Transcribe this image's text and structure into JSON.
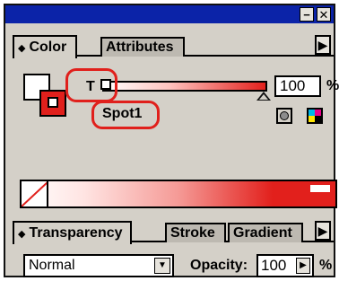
{
  "window": {
    "minimize_label": "−",
    "close_label": "✕"
  },
  "tabs_top": [
    {
      "label": "Color",
      "active": true
    },
    {
      "label": "Attributes",
      "active": false
    }
  ],
  "color": {
    "tint_label": "T",
    "tint_value": "100",
    "percent": "%",
    "swatch_name": "Spot1",
    "fill_color": "#e0201c",
    "icons": [
      "grayscale-icon",
      "cmyk-icon"
    ]
  },
  "tabs_bottom": [
    {
      "label": "Transparency",
      "active": true
    },
    {
      "label": "Stroke",
      "active": false
    },
    {
      "label": "Gradient",
      "active": false
    }
  ],
  "transparency": {
    "blend_mode": "Normal",
    "opacity_label": "Opacity:",
    "opacity_value": "100",
    "percent": "%"
  },
  "colors": {
    "accent": "#e0201c",
    "titlebar": "#0b23a8",
    "panel_bg": "#d4d0c8"
  }
}
